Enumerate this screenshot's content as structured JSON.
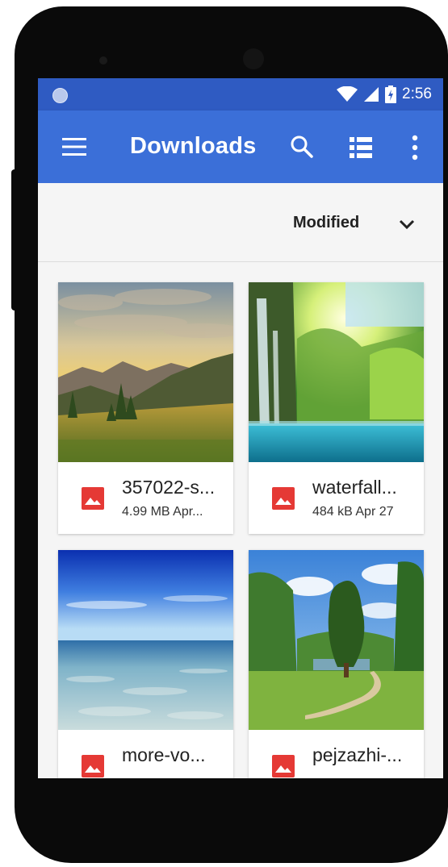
{
  "status_bar": {
    "time": "2:56",
    "icons": [
      "wifi-icon",
      "cell-signal-icon",
      "battery-charging-icon"
    ]
  },
  "toolbar": {
    "title": "Downloads",
    "icons": [
      "menu-icon",
      "search-icon",
      "list-view-icon",
      "more-vert-icon"
    ]
  },
  "sort": {
    "label": "Modified"
  },
  "files": [
    {
      "name": "357022-s...",
      "meta": "4.99 MB Apr..."
    },
    {
      "name": "waterfall...",
      "meta": "484 kB Apr 27"
    },
    {
      "name": "more-vo...",
      "meta": ""
    },
    {
      "name": "pejzazhi-...",
      "meta": ""
    }
  ],
  "colors": {
    "status_bar": "#2f5bc2",
    "toolbar": "#3b6fd8",
    "image_icon": "#e53935"
  }
}
